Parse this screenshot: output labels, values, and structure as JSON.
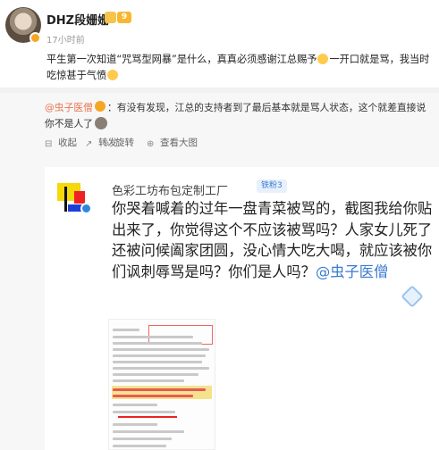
{
  "post": {
    "username": "DHZ段姗姗",
    "level_badge": "9",
    "time": "17小时前",
    "text": "平生第一次知道“咒骂型网暴”是什么，真真必须感谢江总赐予",
    "text_tail": "一开口就是骂，我当时吃惊甚于气愤"
  },
  "repost": {
    "author": "@虫子医僧",
    "text": "：有没有发现，江总的支持者到了最后基本就是骂人状态，这个就差直接说你不是人了",
    "actions": [
      {
        "icon": "collapse-icon",
        "label": "收起"
      },
      {
        "icon": "repost-icon",
        "label": "转发"
      },
      {
        "icon": "rotate-icon",
        "label": "旋转"
      },
      {
        "icon": "zoom-icon",
        "label": "查看大图"
      }
    ]
  },
  "card": {
    "shop_name": "色彩工坊布包定制工厂",
    "fan_badge": "铁粉3",
    "text": "你哭着喊着的过年一盘青菜被骂的，截图我给你贴出来了，你觉得这个不应该被骂吗？人家女儿死了还被问候阖家团圆，没心情大吃大喝，就应该被你们讽刺辱骂是吗？你们是人吗？",
    "mention": "@虫子医僧"
  },
  "colors": {
    "accent_orange": "#eb7350",
    "link_blue": "#3b7bd1",
    "verify_gold": "#f5a623"
  }
}
